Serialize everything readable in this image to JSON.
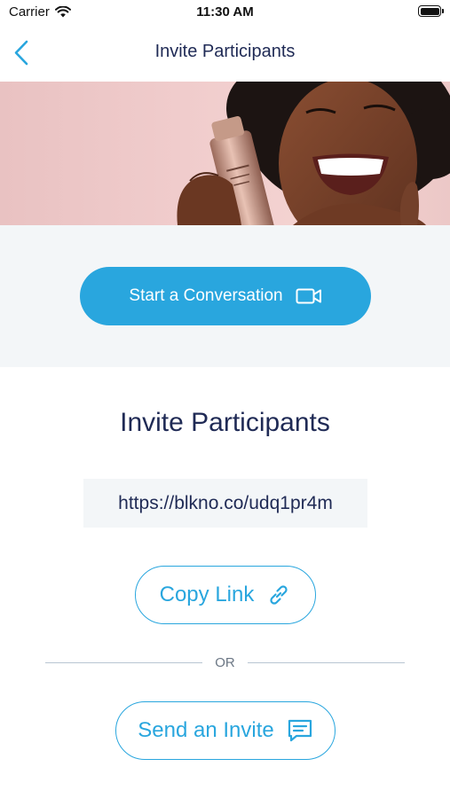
{
  "status_bar": {
    "carrier": "Carrier",
    "time": "11:30 AM",
    "icons": [
      "wifi-icon",
      "battery-icon"
    ]
  },
  "nav": {
    "title": "Invite Participants",
    "back_icon": "chevron-left-icon"
  },
  "hero": {
    "description_icon": "hero-photo-woman-holding-bottle"
  },
  "actions": {
    "start_label": "Start a Conversation",
    "start_icon": "video-camera-icon"
  },
  "invite": {
    "heading": "Invite Participants",
    "link": "https://blkno.co/udq1pr4m",
    "copy_label": "Copy Link",
    "copy_icon": "link-icon",
    "or_label": "OR",
    "send_label": "Send an Invite",
    "send_icon": "message-icon"
  },
  "colors": {
    "accent": "#29a6de",
    "text_dark": "#1f2a55",
    "panel_bg": "#f3f6f8",
    "hero_bg": "#f0cccc"
  }
}
